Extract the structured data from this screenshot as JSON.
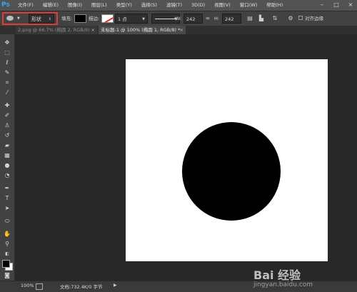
{
  "app": {
    "logo": "Ps"
  },
  "menu": [
    "文件(F)",
    "编辑(E)",
    "图像(I)",
    "图层(L)",
    "类型(Y)",
    "选择(S)",
    "滤镜(T)",
    "3D(D)",
    "视图(V)",
    "窗口(W)",
    "帮助(H)"
  ],
  "options": {
    "mode": "形状",
    "fill_label": "填充:",
    "stroke_label": "描边:",
    "stroke_width": "1 点",
    "w_label": "W:",
    "w_value": "242 像:",
    "link_icon": "∞",
    "h_label": "H:",
    "h_value": "242 像:",
    "align_edges": "对齐边缘"
  },
  "tabs": [
    {
      "label": "2.png @ 66.7% (椭圆 2, RGB/8)"
    },
    {
      "label": "未标题-1 @ 100% (椭圆 1, RGB/8) *"
    }
  ],
  "status": {
    "zoom": "100%",
    "doc": "文档:732.4K/0 字节"
  },
  "watermark": {
    "brand": "Bai 经验",
    "url": "jingyan.baidu.com"
  },
  "colors": {
    "foreground": "#000000",
    "background": "#ffffff",
    "highlight": "#e03a3a"
  },
  "icons": [
    "ellipse-tool-icon",
    "close-icon",
    "minimize-icon",
    "maximize-icon"
  ]
}
